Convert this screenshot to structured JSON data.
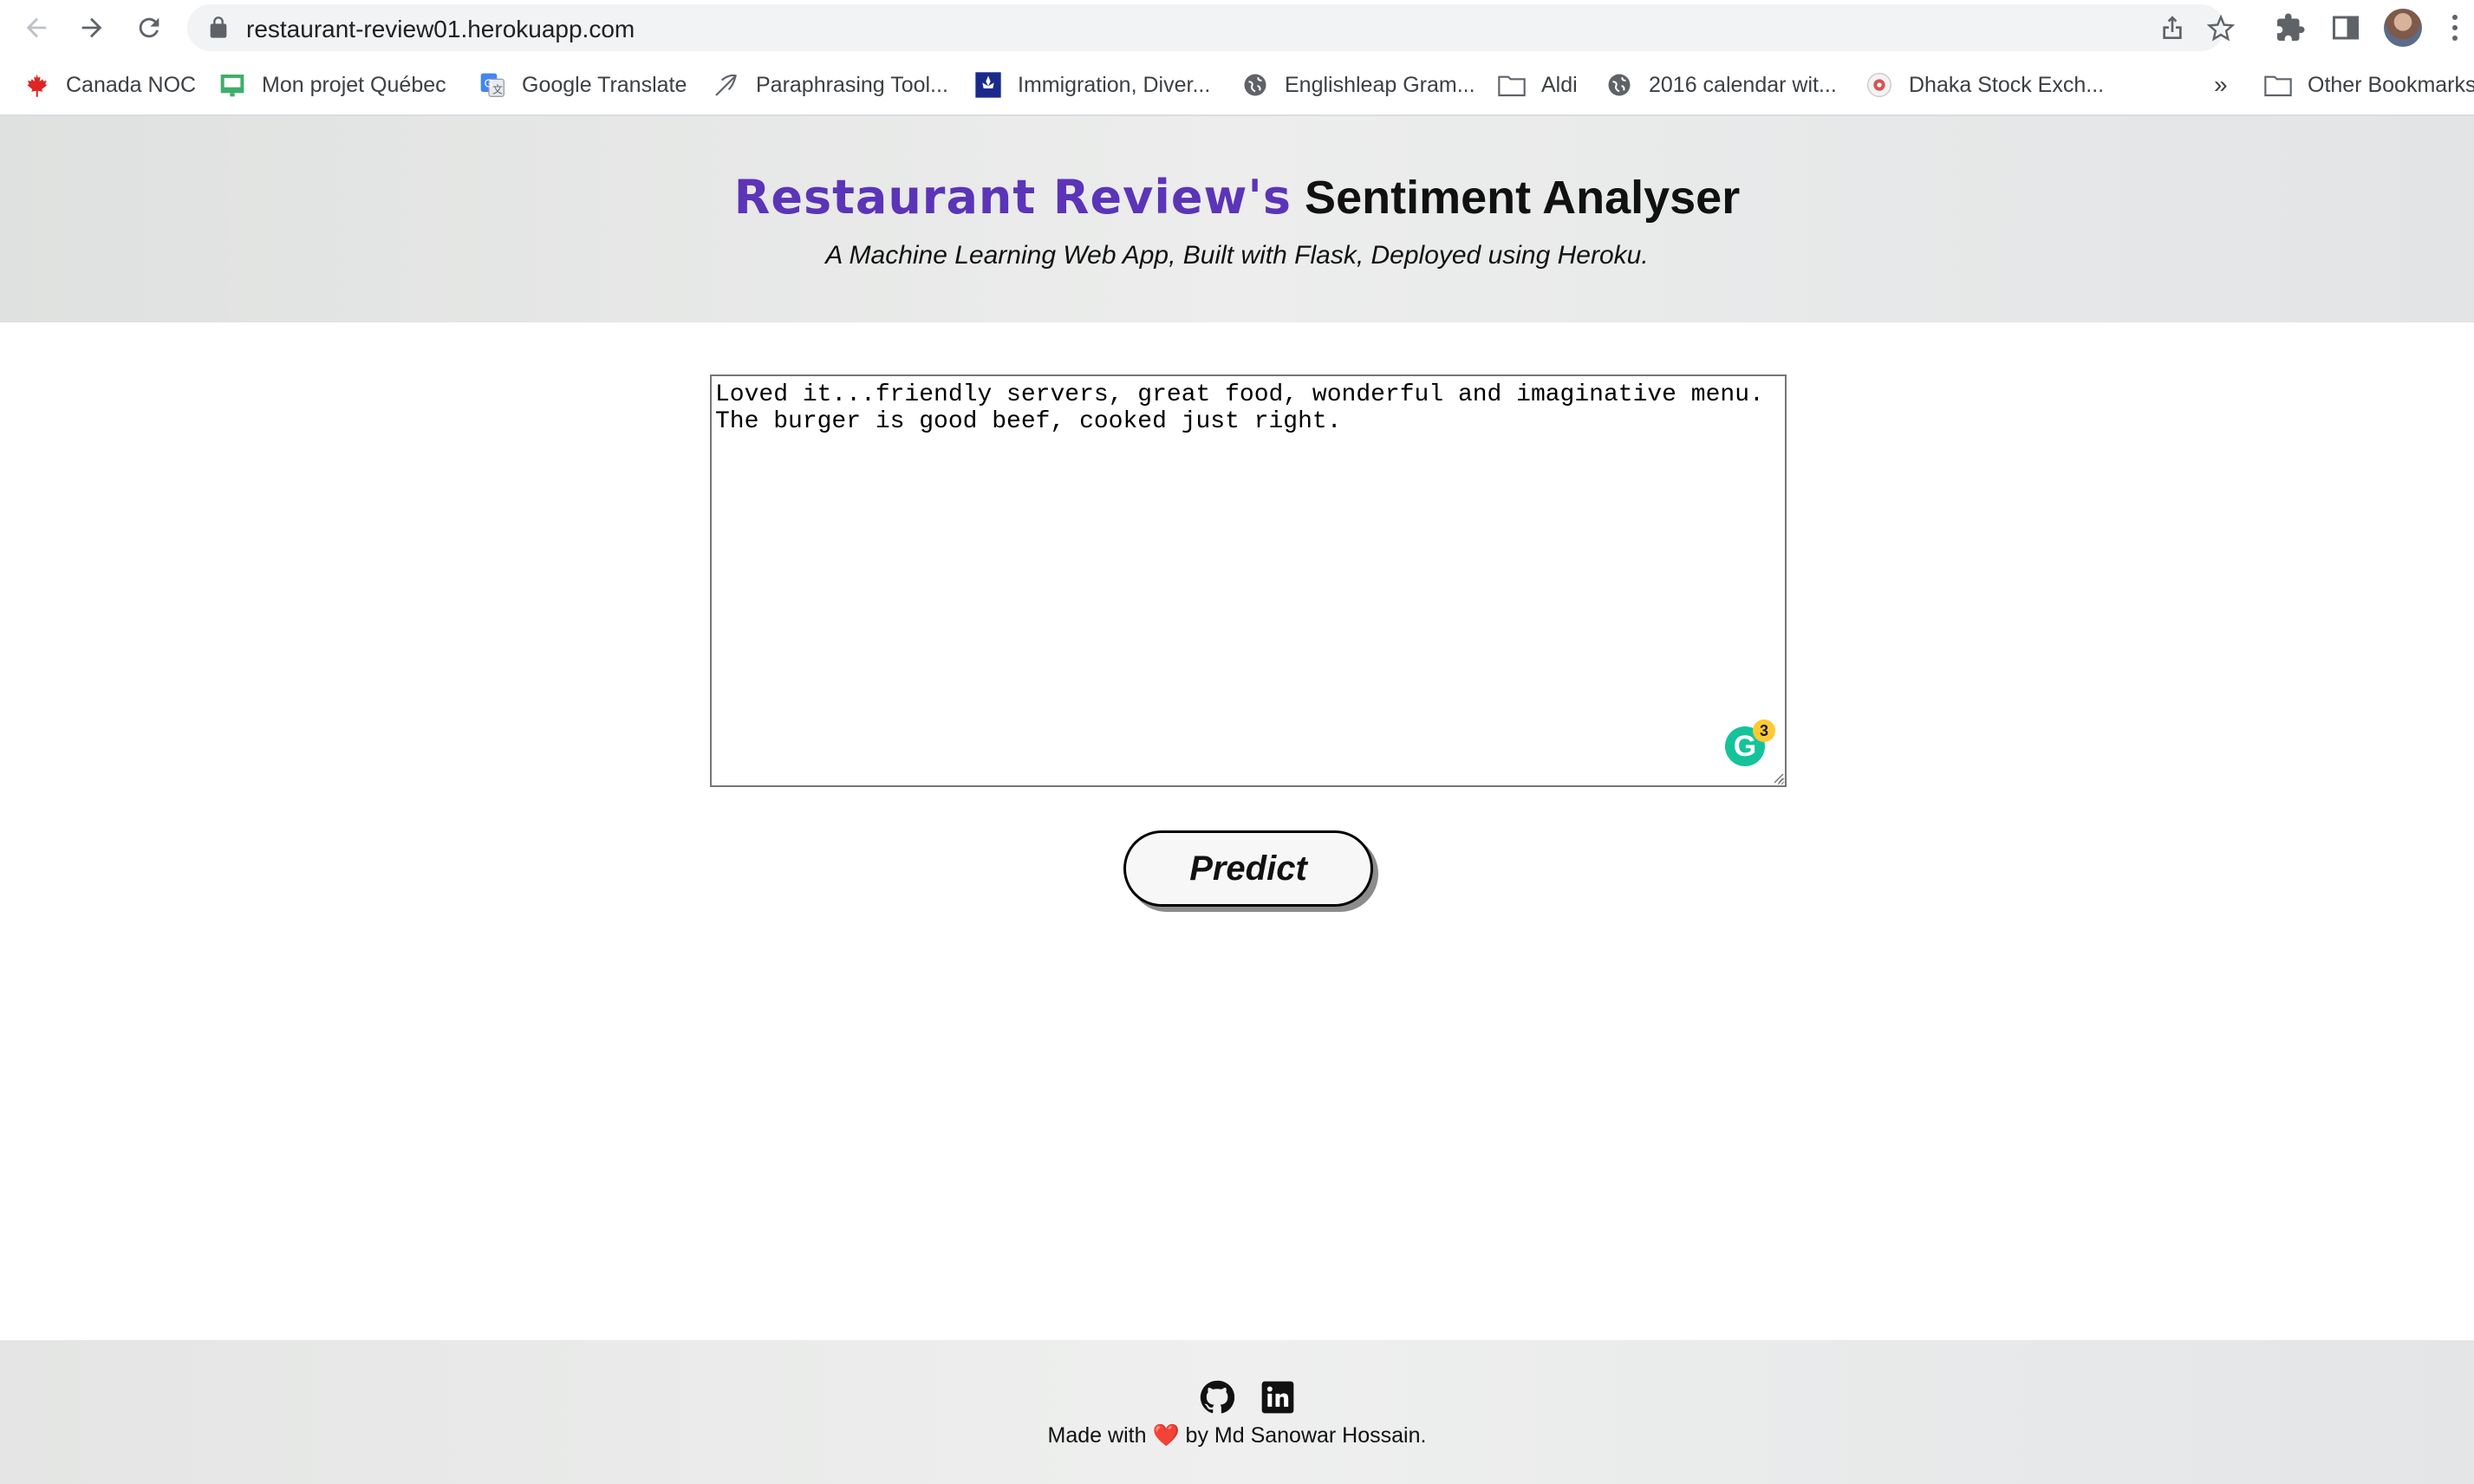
{
  "browser": {
    "url": "restaurant-review01.herokuapp.com",
    "bookmarks": [
      {
        "label": "Canada NOC",
        "icon": "maple-leaf-icon"
      },
      {
        "label": "Mon projet Québec",
        "icon": "project-icon"
      },
      {
        "label": "Google Translate",
        "icon": "translate-icon"
      },
      {
        "label": "Paraphrasing Tool...",
        "icon": "feather-icon"
      },
      {
        "label": "Immigration, Diver...",
        "icon": "quebec-flag-icon"
      },
      {
        "label": "Englishleap Gram...",
        "icon": "globe-icon"
      },
      {
        "label": "Aldi",
        "icon": "folder-icon"
      },
      {
        "label": "2016 calendar wit...",
        "icon": "globe-icon"
      },
      {
        "label": "Dhaka Stock Exch...",
        "icon": "dse-icon"
      }
    ],
    "overflow_label": "»",
    "other_bookmarks": "Other Bookmarks"
  },
  "header": {
    "title_brand": "Restaurant Review's",
    "title_rest": " Sentiment Analyser",
    "subtitle": "A Machine Learning Web App, Built with Flask, Deployed using Heroku."
  },
  "form": {
    "review_text": "Loved it...friendly servers, great food, wonderful and imaginative menu. The burger is good beef, cooked just right.",
    "grammarly_count": "3",
    "predict_label": "Predict"
  },
  "footer": {
    "made_with": "Made with",
    "heart": "❤️",
    "by": "by Md Sanowar Hossain."
  },
  "colors": {
    "brand": "#5b34b8",
    "grammarly": "#15c39a"
  }
}
